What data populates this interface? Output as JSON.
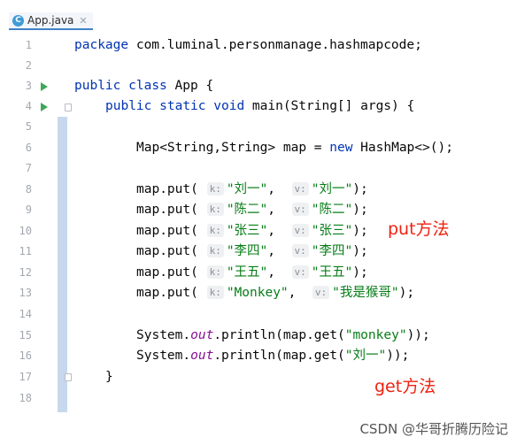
{
  "tab": {
    "label": "App.java",
    "icon": "java-class-icon"
  },
  "line_numbers": [
    "1",
    "2",
    "3",
    "4",
    "5",
    "6",
    "7",
    "8",
    "9",
    "10",
    "11",
    "12",
    "13",
    "14",
    "15",
    "16",
    "17",
    "18"
  ],
  "code": {
    "l1": {
      "kw": "package",
      "rest": " com.luminal.personmanage.hashmapcode;"
    },
    "l3": {
      "kw1": "public",
      "kw2": "class",
      "rest": " App {"
    },
    "l4": {
      "kw1": "public",
      "kw2": "static",
      "kw3": "void",
      "rest": " main(String[] args) {"
    },
    "l6": {
      "a": "Map<String,String> map = ",
      "kw": "new",
      "b": " HashMap<>();"
    },
    "puts": [
      {
        "k": "\"刘一\"",
        "v": "\"刘一\""
      },
      {
        "k": "\"陈二\"",
        "v": "\"陈二\""
      },
      {
        "k": "\"张三\"",
        "v": "\"张三\""
      },
      {
        "k": "\"李四\"",
        "v": "\"李四\""
      },
      {
        "k": "\"王五\"",
        "v": "\"王五\""
      },
      {
        "k": "\"Monkey\"",
        "v": "\"我是猴哥\""
      }
    ],
    "put_prefix": "map.put(",
    "sep": ",",
    "end": ");",
    "hint_k": "k:",
    "hint_v": "v:",
    "gets": [
      {
        "pre": "System.",
        "fld": "out",
        "mid": ".println(map.get(",
        "arg": "\"monkey\"",
        "end": "));"
      },
      {
        "pre": "System.",
        "fld": "out",
        "mid": ".println(map.get(",
        "arg": "\"刘一\"",
        "end": "));"
      }
    ],
    "l17": "}"
  },
  "annotations": {
    "put": "put方法",
    "get": "get方法"
  },
  "watermark": "CSDN @华哥折腾历险记",
  "colors": {
    "keyword": "#0033b3",
    "string": "#067d17",
    "field": "#871094",
    "annotation": "#ee2211"
  }
}
